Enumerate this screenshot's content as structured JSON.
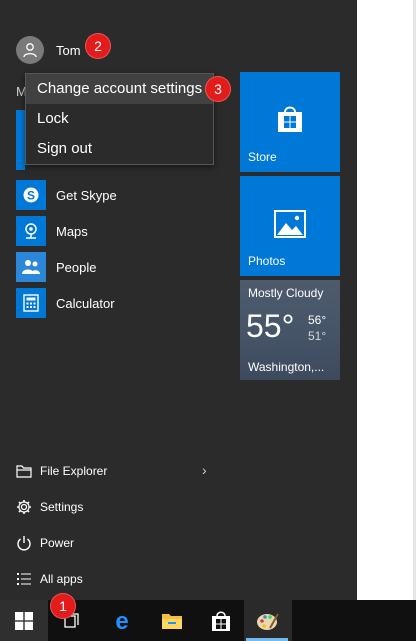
{
  "user": {
    "name": "Tom"
  },
  "section_letter": "M",
  "account_menu": {
    "items": [
      "Change account settings",
      "Lock",
      "Sign out"
    ]
  },
  "apps": [
    {
      "name": "skype-icon",
      "label": "Get Skype"
    },
    {
      "name": "maps-icon",
      "label": "Maps"
    },
    {
      "name": "people-icon",
      "label": "People"
    },
    {
      "name": "calculator-icon",
      "label": "Calculator"
    }
  ],
  "tiles": {
    "store": "Store",
    "photos": "Photos",
    "weather": {
      "condition": "Mostly Cloudy",
      "temp": "55°",
      "high": "56°",
      "low": "51°",
      "city": "Washington,..."
    }
  },
  "bottom": {
    "file_explorer": "File Explorer",
    "settings": "Settings",
    "power": "Power",
    "all_apps": "All apps"
  },
  "badges": [
    "1",
    "2",
    "3"
  ],
  "colors": {
    "accent": "#0078d7",
    "badge": "#e31b1b",
    "menu_bg": "#2b2b2b"
  }
}
